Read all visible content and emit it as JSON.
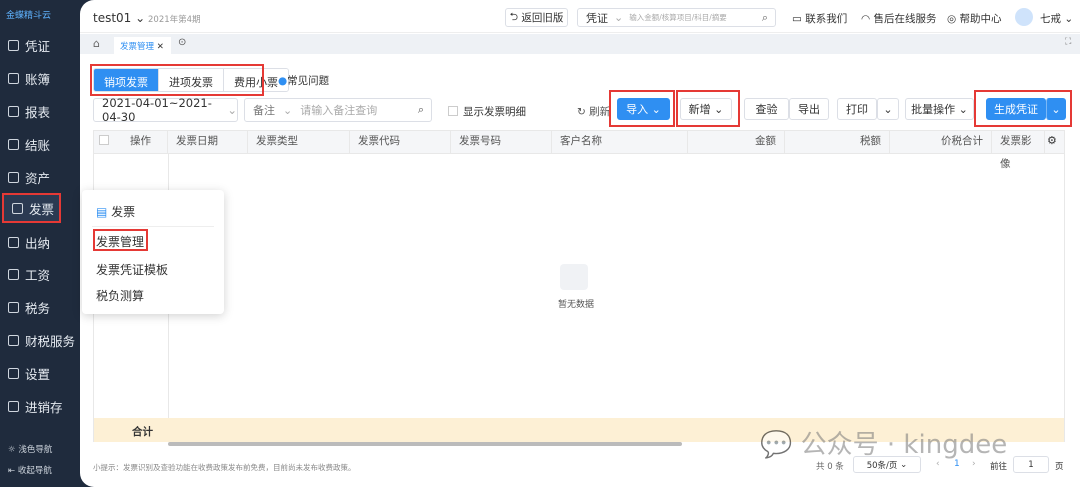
{
  "brand": "金蝶精斗云",
  "sidebar": {
    "items": [
      {
        "label": "凭证"
      },
      {
        "label": "账簿"
      },
      {
        "label": "报表"
      },
      {
        "label": "结账"
      },
      {
        "label": "资产"
      },
      {
        "label": "发票",
        "active": true
      },
      {
        "label": "出纳"
      },
      {
        "label": "工资"
      },
      {
        "label": "税务"
      },
      {
        "label": "财税服务"
      },
      {
        "label": "设置"
      },
      {
        "label": "进销存"
      }
    ],
    "light_nav": "浅色导航",
    "collapse_nav": "收起导航"
  },
  "flyout": {
    "title": "发票",
    "items": [
      "发票管理",
      "发票凭证模板",
      "税负测算"
    ]
  },
  "header": {
    "account": "test01",
    "period": "2021年第4期",
    "back_old": "返回旧版",
    "search_type": "凭证",
    "search_placeholder": "输入金额/核算项目/科目/摘要",
    "contact": "联系我们",
    "service": "售后在线服务",
    "help": "帮助中心",
    "user": "七戒"
  },
  "tabbar": {
    "tab": "发票管理"
  },
  "tabs": [
    {
      "label": "销项发票",
      "active": true
    },
    {
      "label": "进项发票"
    },
    {
      "label": "费用小票"
    }
  ],
  "faq": "常见问题",
  "toolbar": {
    "date_range": "2021-04-01~2021-04-30",
    "filter_field": "备注",
    "filter_placeholder": "请输入备注查询",
    "show_detail": "显示发票明细",
    "refresh": "刷新",
    "import": "导入",
    "add": "新增",
    "verify": "查验",
    "export": "导出",
    "print": "打印",
    "batch": "批量操作",
    "gen_voucher": "生成凭证"
  },
  "table": {
    "columns": [
      "操作",
      "发票日期",
      "发票类型",
      "发票代码",
      "发票号码",
      "客户名称",
      "金额",
      "税额",
      "价税合计",
      "发票影像"
    ],
    "empty": "暂无数据",
    "total_label": "合计"
  },
  "footer": {
    "tip": "小提示：发票识别及查验功能在收费政策发布前免费，目前尚未发布收费政策。",
    "total": "共 0 条",
    "page_size": "50条/页",
    "page": "1",
    "goto": "前往",
    "goto_value": "1",
    "page_unit": "页"
  },
  "watermark": "公众号 · kingdee",
  "colors": {
    "primary": "#2f8ff2",
    "sidebar": "#1f2b3d",
    "highlight": "#e53935",
    "total_row": "#fdf0d5"
  }
}
